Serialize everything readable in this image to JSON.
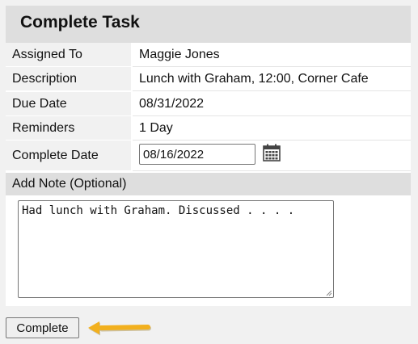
{
  "header": {
    "title": "Complete Task"
  },
  "fields": {
    "assigned_to": {
      "label": "Assigned To",
      "value": "Maggie Jones"
    },
    "description": {
      "label": "Description",
      "value": "Lunch with Graham, 12:00, Corner Cafe"
    },
    "due_date": {
      "label": "Due Date",
      "value": "08/31/2022"
    },
    "reminders": {
      "label": "Reminders",
      "value": "1 Day"
    },
    "complete_date": {
      "label": "Complete Date",
      "value": "08/16/2022"
    }
  },
  "note": {
    "label": "Add Note (Optional)",
    "value": "Had lunch with Graham. Discussed . . . ."
  },
  "actions": {
    "complete_label": "Complete"
  },
  "colors": {
    "arrow": "#f2b01e",
    "header_bg": "#dedede",
    "label_bg": "#f1f1f1"
  },
  "icons": {
    "calendar": "calendar-icon",
    "pointer": "arrow-left-icon"
  }
}
